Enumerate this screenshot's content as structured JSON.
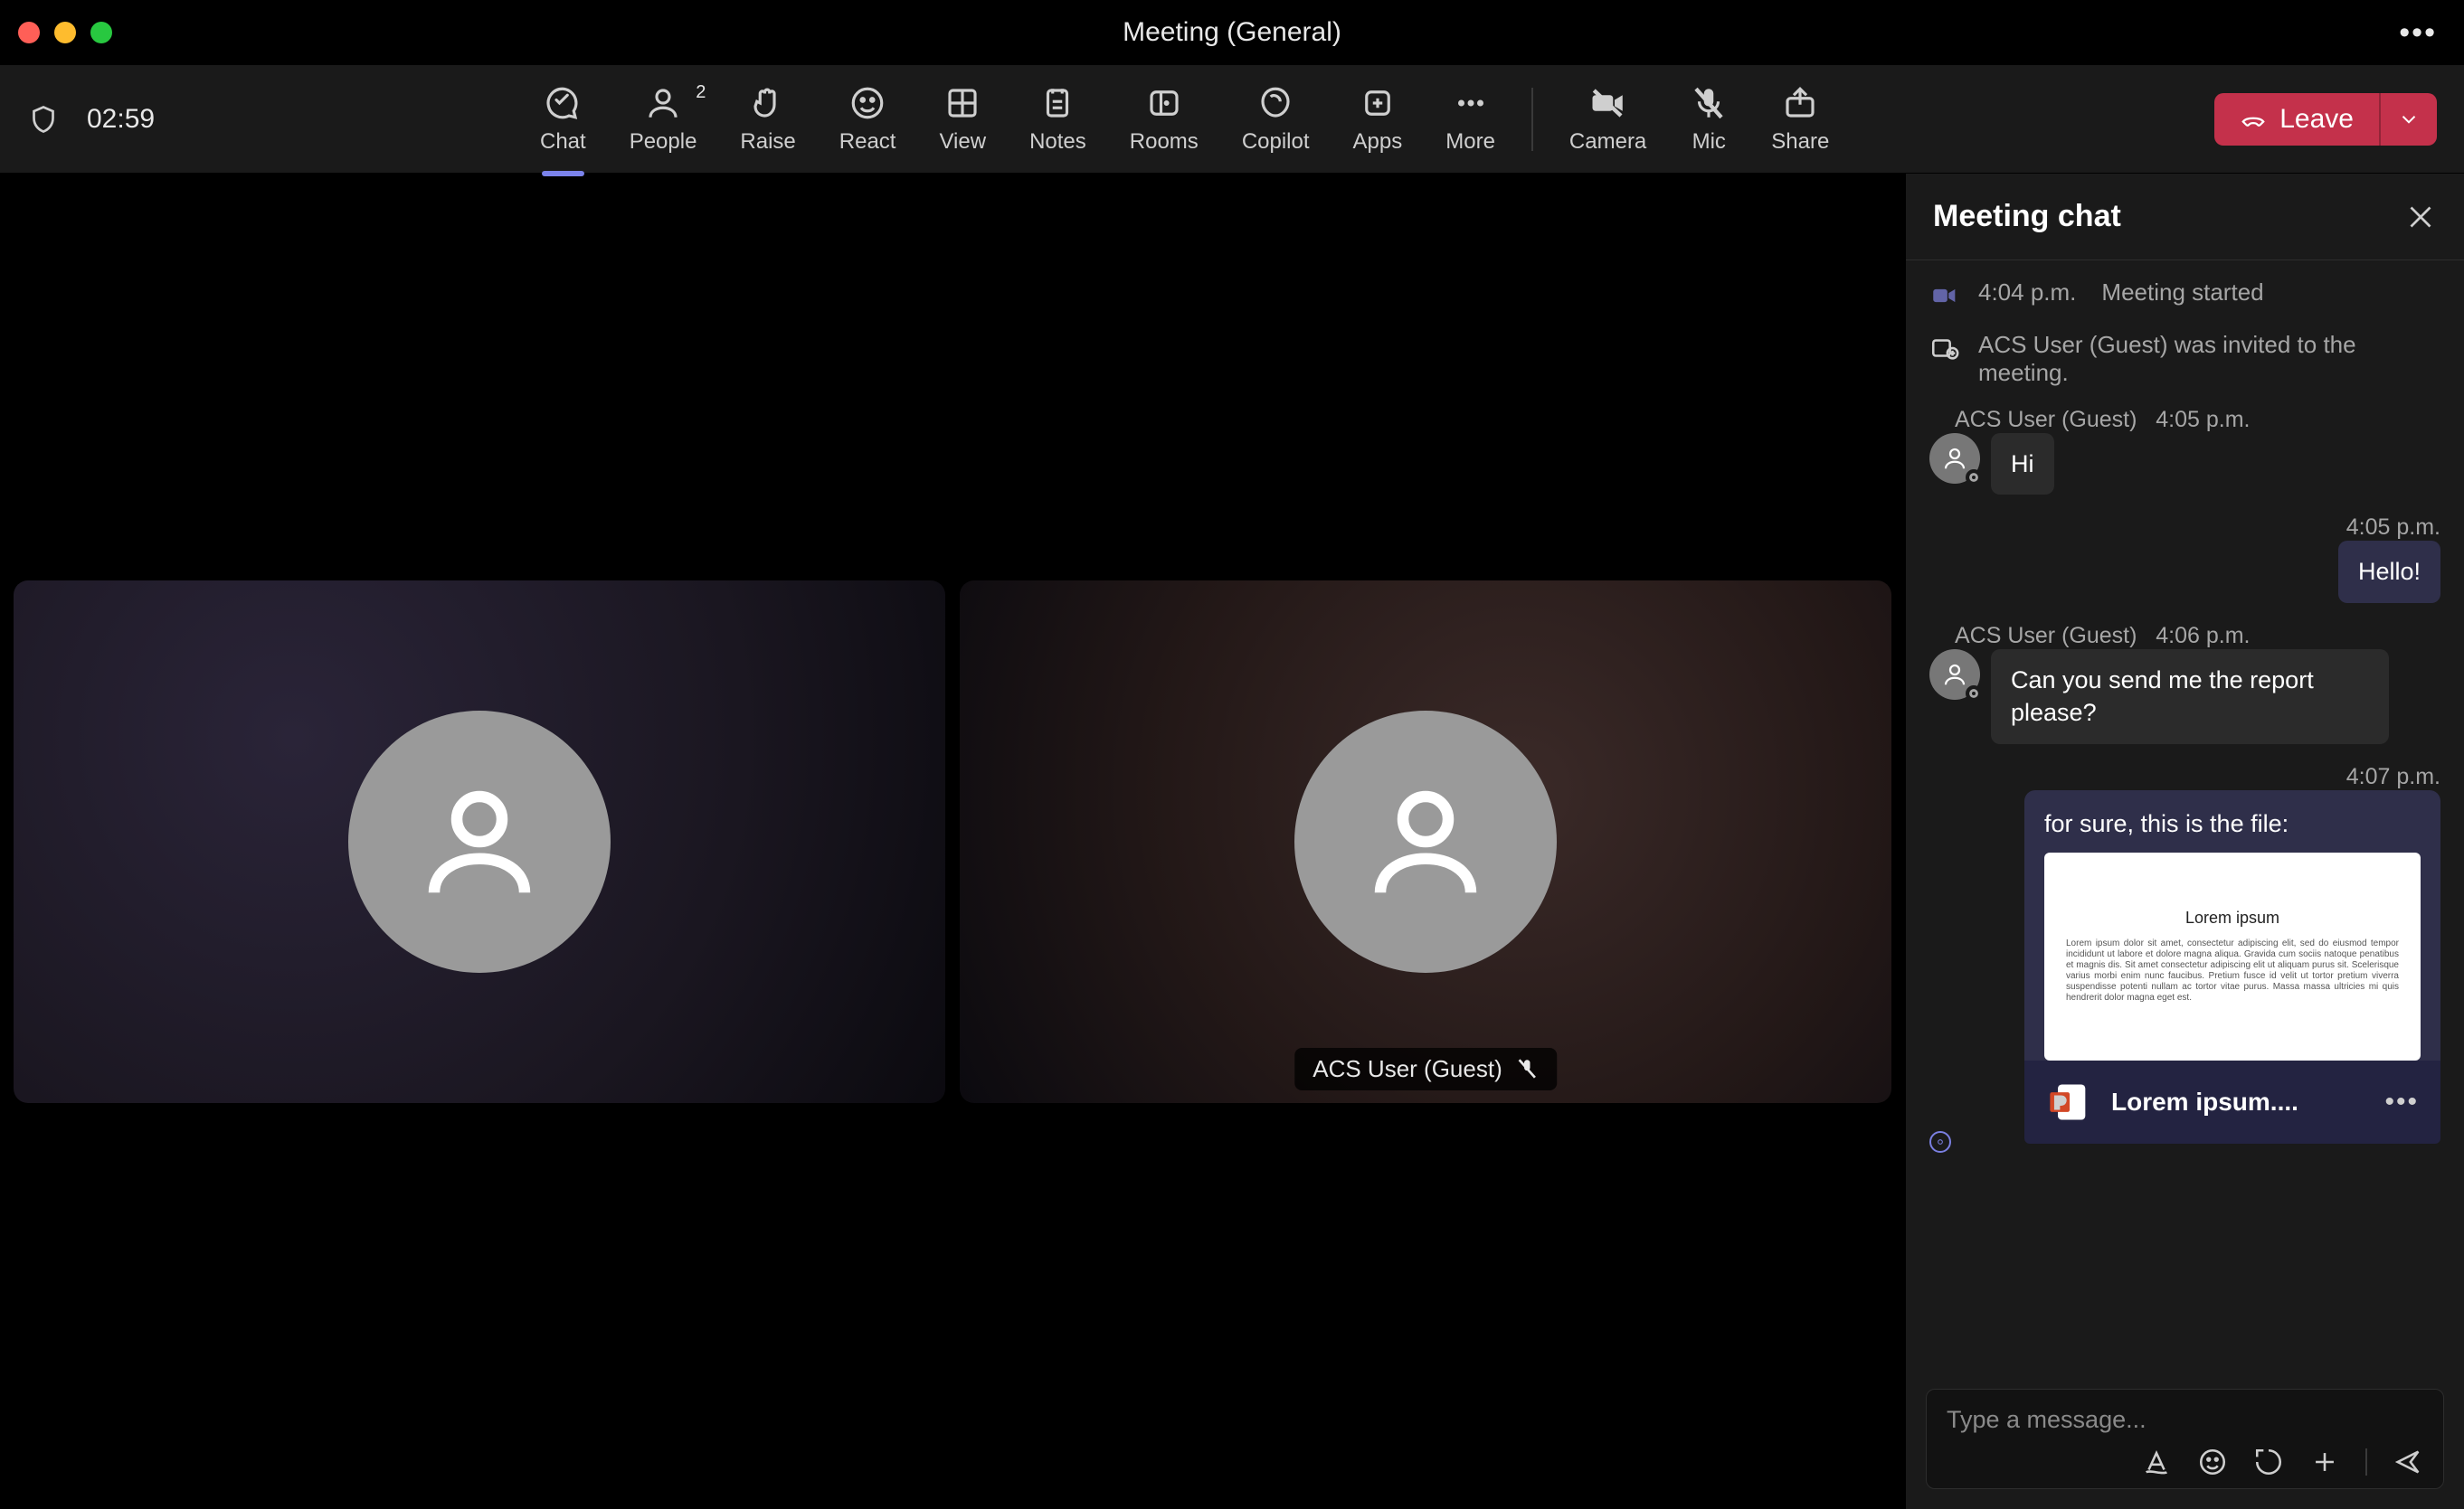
{
  "window": {
    "title": "Meeting (General)"
  },
  "timer": "02:59",
  "toolbar": {
    "chat": "Chat",
    "people": "People",
    "people_count": "2",
    "raise": "Raise",
    "react": "React",
    "view": "View",
    "notes": "Notes",
    "rooms": "Rooms",
    "copilot": "Copilot",
    "apps": "Apps",
    "more": "More",
    "camera": "Camera",
    "mic": "Mic",
    "share": "Share",
    "leave": "Leave"
  },
  "participants": [
    {
      "name": ""
    },
    {
      "name": "ACS User (Guest)",
      "muted": true
    }
  ],
  "chat": {
    "title": "Meeting chat",
    "events": {
      "started_time": "4:04 p.m.",
      "started_text": "Meeting started",
      "invited_text": "ACS User (Guest) was invited to the meeting."
    },
    "messages": [
      {
        "author": "ACS User (Guest)",
        "time": "4:05 p.m.",
        "text": "Hi",
        "mine": false
      },
      {
        "time": "4:05 p.m.",
        "text": "Hello!",
        "mine": true
      },
      {
        "author": "ACS User (Guest)",
        "time": "4:06 p.m.",
        "text": "Can you send me the report please?",
        "mine": false
      },
      {
        "time": "4:07 p.m.",
        "text": "for sure, this is the file:",
        "mine": true,
        "attachment": {
          "thumb_title": "Lorem ipsum",
          "thumb_body": "Lorem ipsum dolor sit amet, consectetur adipiscing elit, sed do eiusmod tempor incididunt ut labore et dolore magna aliqua. Gravida cum sociis natoque penatibus et magnis dis. Sit amet consectetur adipiscing elit ut aliquam purus sit. Scelerisque varius morbi enim nunc faucibus. Pretium fusce id velit ut tortor pretium viverra suspendisse potenti nullam ac tortor vitae purus. Massa massa ultricies mi quis hendrerit dolor magna eget est.",
          "filename": "Lorem ipsum...."
        }
      }
    ],
    "compose_placeholder": "Type a message..."
  }
}
